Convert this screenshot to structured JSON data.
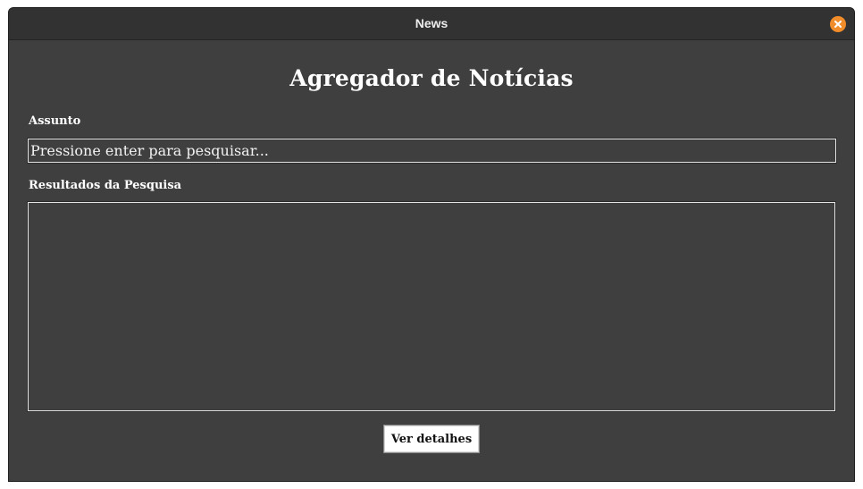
{
  "window": {
    "title": "News",
    "close_icon": "close-icon"
  },
  "app": {
    "heading": "Agregador de Notícias"
  },
  "search": {
    "label": "Assunto",
    "placeholder": "Pressione enter para pesquisar...",
    "value": ""
  },
  "results": {
    "label": "Resultados da Pesquisa",
    "items": []
  },
  "actions": {
    "details_label": "Ver detalhes"
  },
  "colors": {
    "background": "#3f3f3f",
    "titlebar": "#323232",
    "close_button": "#f08c2a",
    "text": "#ffffff"
  }
}
